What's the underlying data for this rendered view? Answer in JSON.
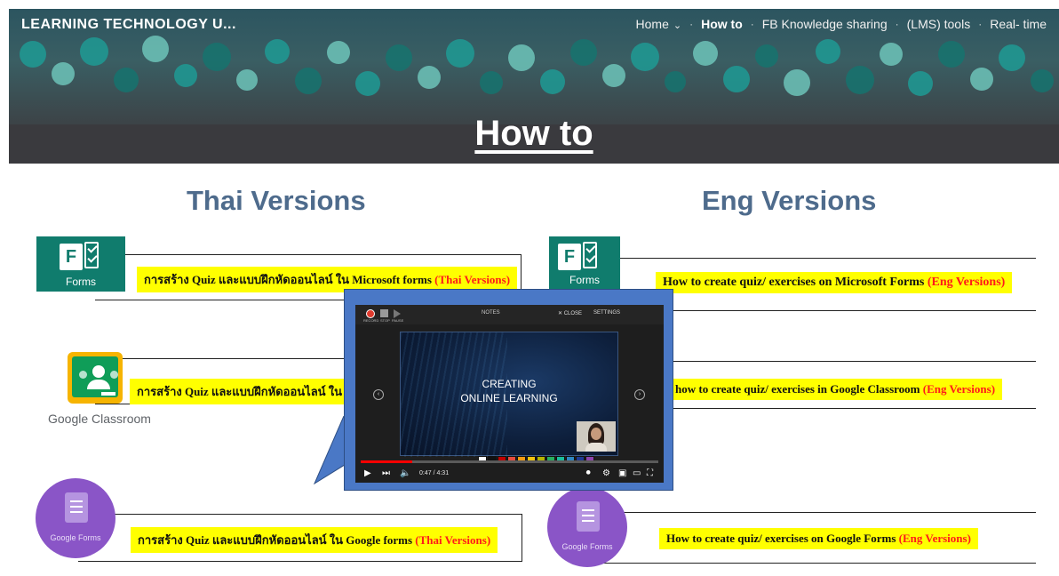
{
  "header": {
    "site_title": "LEARNING TECHNOLOGY U...",
    "nav": [
      {
        "label": "Home",
        "has_dropdown": true,
        "active": false
      },
      {
        "label": "How to",
        "active": true
      },
      {
        "label": "FB Knowledge sharing",
        "active": false
      },
      {
        "label": "(LMS) tools",
        "active": false
      },
      {
        "label": "Real- time",
        "active": false
      }
    ],
    "page_title": "How to"
  },
  "sections": {
    "thai_heading": "Thai Versions",
    "eng_heading": "Eng Versions"
  },
  "thai_items": [
    {
      "app": "Forms",
      "text": "การสร้าง Quiz และแบบฝึกหัดออนไลน์ ใน Microsoft forms ",
      "tag": "(Thai Versions)"
    },
    {
      "app": "Google Classroom",
      "text": "การสร้าง Quiz และแบบฝึกหัดออนไลน์ ใน C"
    },
    {
      "app": "Google Forms",
      "text": "การสร้าง Quiz และแบบฝึกหัดออนไลน์ ใน Google forms ",
      "tag": "(Thai Versions)"
    }
  ],
  "eng_items": [
    {
      "app": "Forms",
      "text": "How to create quiz/ exercises on Microsoft Forms ",
      "tag": "(Eng Versions)"
    },
    {
      "app": "Google Classroom",
      "text": "how to create quiz/ exercises in Google Classroom ",
      "tag": "(Eng Versions)"
    },
    {
      "app": "Google Forms",
      "text": "How to create quiz/ exercises on Google Forms ",
      "tag": "(Eng Versions)"
    }
  ],
  "video": {
    "slide_title_line1": "CREATING",
    "slide_title_line2": "ONLINE LEARNING",
    "time": "0:47 / 4:31",
    "progress_fraction": 0.173,
    "toolbar": {
      "record": "RECORD",
      "stop": "STOP",
      "pause": "PAUSE",
      "notes": "NOTES",
      "close": "CLOSE",
      "settings": "SETTINGS"
    }
  },
  "colors": {
    "accent_heading": "#4e6b8c",
    "highlight": "#ffff00",
    "tag_red": "#ff1a1a",
    "popup_frame": "#4a78c6",
    "palette": [
      "#ffffff",
      "#111111",
      "#c00000",
      "#e74c3c",
      "#f39c12",
      "#f1c40f",
      "#b5b500",
      "#27ae60",
      "#1abc9c",
      "#2e86c1",
      "#1f3a93",
      "#8e44ad"
    ]
  },
  "icons": [
    "microsoft-forms-icon",
    "google-classroom-icon",
    "google-forms-icon",
    "play-icon",
    "next-icon",
    "volume-icon",
    "settings-icon",
    "fullscreen-icon"
  ]
}
